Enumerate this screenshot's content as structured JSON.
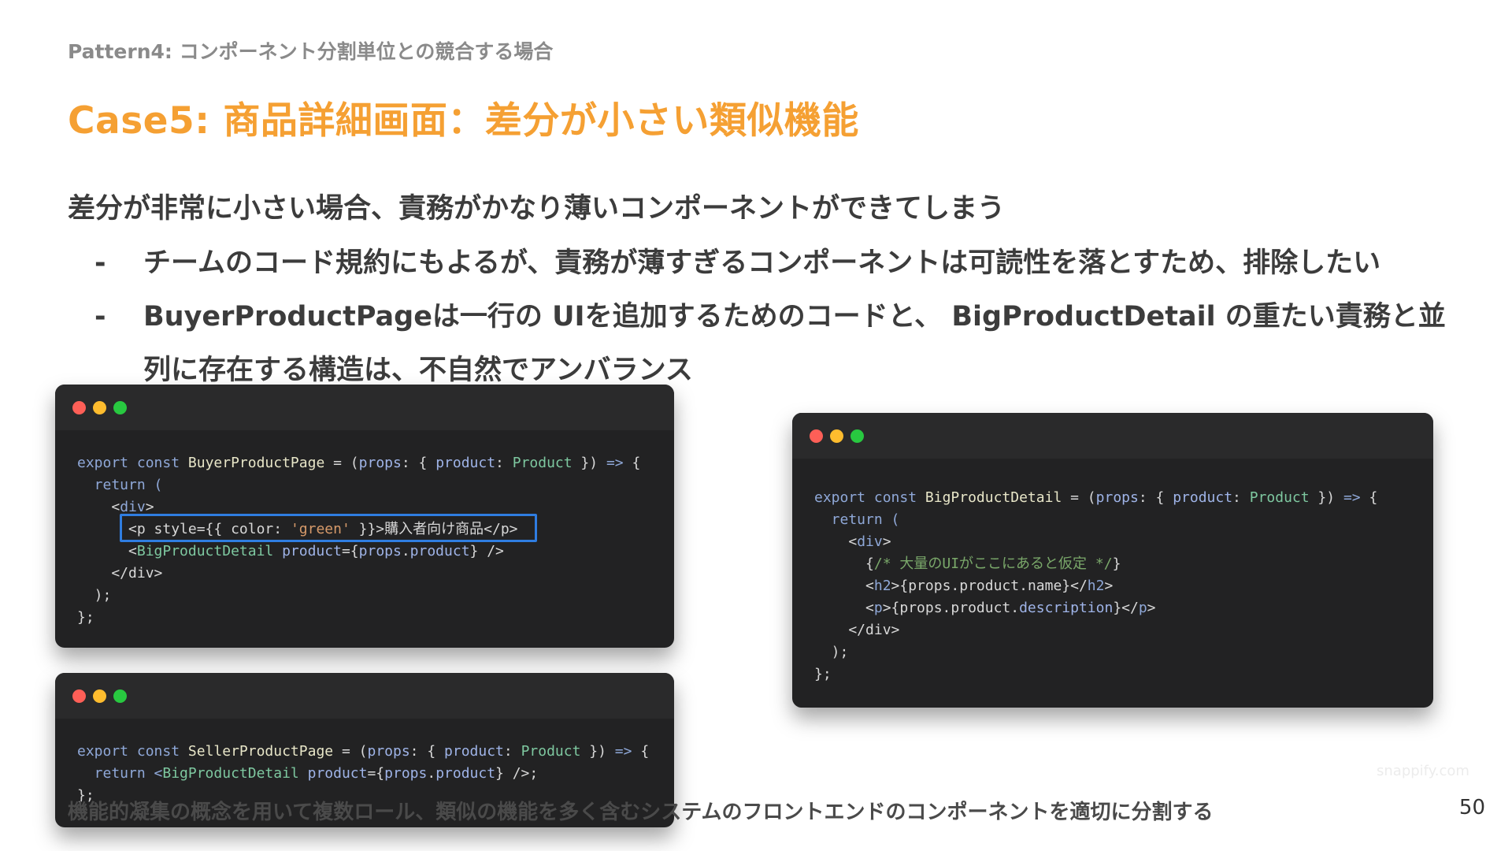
{
  "header": {
    "pattern_label": "Pattern4: コンポーネント分割単位との競合する場合",
    "title": "Case5: 商品詳細画面：差分が小さい類似機能"
  },
  "body": {
    "lead": "差分が非常に小さい場合、責務がかなり薄いコンポーネントができてしまう",
    "bullets": [
      {
        "dash": "-",
        "text": "チームのコード規約にもよるが、責務が薄すぎるコンポーネントは可読性を落とすため、排除したい"
      },
      {
        "dash": "-",
        "text": "BuyerProductPageは一行の UIを追加するためのコードと、 BigProductDetail の重たい責務と並列に存在する構造は、不自然でアンバランス"
      }
    ]
  },
  "code_windows": {
    "buyer": {
      "lines": {
        "l1_kw": "export const ",
        "l1_name": "BuyerProductPage",
        "l1_eq": " = (",
        "l1_props": "props",
        "l1_colon": ": { ",
        "l1_product": "product",
        "l1_colon2": ": ",
        "l1_type": "Product",
        "l1_end": " }) ",
        "l1_arrow": "=>",
        "l1_brace": " {",
        "l2": "  return (",
        "l3_open": "    <",
        "l3_tag": "div",
        "l3_close": ">",
        "l4_a": "      <p style={{ color: ",
        "l4_str": "'green'",
        "l4_b": " }}>購入者向け商品</p>",
        "l5_a": "      <",
        "l5_tag": "BigProductDetail",
        "l5_attr": " product",
        "l5_b": "={",
        "l5_props": "props",
        "l5_dot": ".",
        "l5_prod": "product",
        "l5_c": "} />",
        "l6": "    </div>",
        "l7": "  );",
        "l8": "};"
      }
    },
    "seller": {
      "lines": {
        "l1_kw": "export const ",
        "l1_name": "SellerProductPage",
        "l1_eq": " = (",
        "l1_props": "props",
        "l1_colon": ": { ",
        "l1_product": "product",
        "l1_colon2": ": ",
        "l1_type": "Product",
        "l1_end": " }) ",
        "l1_arrow": "=>",
        "l1_brace": " {",
        "l2_a": "  return <",
        "l2_tag": "BigProductDetail",
        "l2_attr": " product",
        "l2_b": "={",
        "l2_props": "props",
        "l2_dot": ".",
        "l2_prod": "product",
        "l2_c": "} />;",
        "l3": "};"
      }
    },
    "detail": {
      "lines": {
        "l1_kw": "export const ",
        "l1_name": "BigProductDetail",
        "l1_eq": " = (",
        "l1_props": "props",
        "l1_colon": ": { ",
        "l1_product": "product",
        "l1_colon2": ": ",
        "l1_type": "Product",
        "l1_end": " }) ",
        "l1_arrow": "=>",
        "l1_brace": " {",
        "l2": "  return (",
        "l3_open": "    <",
        "l3_tag": "div",
        "l3_close": ">",
        "l4_a": "      {",
        "l4_cm": "/* 大量のUIがここにあると仮定 */",
        "l4_b": "}",
        "l5_a": "      <",
        "l5_tag": "h2",
        "l5_b": ">{props.product.name}</",
        "l5_tag2": "h2",
        "l5_c": ">",
        "l6_a": "      <",
        "l6_tag": "p",
        "l6_b": ">{props.product.",
        "l6_desc": "description",
        "l6_c": "}</",
        "l6_tag2": "p",
        "l6_d": ">",
        "l7": "    </div>",
        "l8": "  );",
        "l9": "};"
      }
    }
  },
  "watermark": "snappify.com",
  "footer": {
    "text": "機能的凝集の概念を用いて複数ロール、類似の機能を多く含むシステムのフロントエンドのコンポーネントを適切に分割する",
    "page_number": "50"
  },
  "colors": {
    "title": "#f5a033",
    "highlight": "#2f7de1",
    "code_bg": "#222223"
  }
}
